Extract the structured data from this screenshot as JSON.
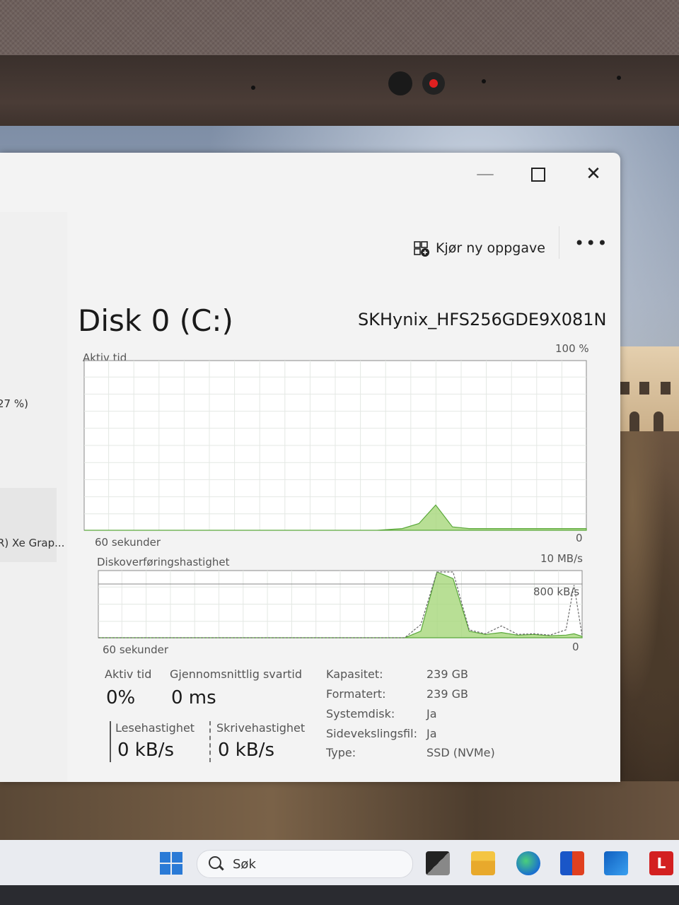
{
  "window": {
    "controls": {
      "minimize": "—",
      "close": "✕"
    },
    "toolbar": {
      "run_task_label": "Kjør ny oppgave",
      "more_label": "•••"
    },
    "sidebar": {
      "partial_pct": "27 %)",
      "partial_gpu": "R) Xe Grap..."
    }
  },
  "disk": {
    "title": "Disk 0 (C:)",
    "model": "SKHynix_HFS256GDE9X081N"
  },
  "charts": {
    "active_time": {
      "label": "Aktiv tid",
      "max_label": "100 %",
      "min_label": "0",
      "time_label": "60 sekunder"
    },
    "transfer": {
      "label": "Diskoverføringshastighet",
      "max_label": "10 MB/s",
      "mid_label": "800 kB/s",
      "min_label": "0",
      "time_label": "60 sekunder"
    }
  },
  "chart_data": [
    {
      "type": "area",
      "title": "Aktiv tid",
      "ylim": [
        0,
        100
      ],
      "x": [
        0,
        5,
        10,
        15,
        20,
        25,
        30,
        35,
        38,
        40,
        42,
        44,
        46,
        48,
        50,
        52,
        54,
        56,
        58,
        60
      ],
      "values": [
        0,
        0,
        0,
        0,
        0,
        0,
        0,
        0,
        1,
        4,
        15,
        2,
        1,
        1,
        1,
        1,
        1,
        1,
        1,
        1
      ],
      "unit": "%"
    },
    {
      "type": "area",
      "title": "Diskoverføringshastighet",
      "ylim": [
        0,
        10
      ],
      "unit": "MB/s",
      "x": [
        0,
        5,
        10,
        15,
        20,
        25,
        30,
        35,
        38,
        40,
        42,
        44,
        46,
        48,
        50,
        52,
        54,
        56,
        58,
        59,
        60
      ],
      "series": [
        {
          "values": [
            0,
            0,
            0,
            0,
            0,
            0,
            0,
            0,
            0,
            1,
            10,
            9,
            1,
            0.5,
            0.8,
            0.4,
            0.5,
            0.3,
            0.4,
            0.6,
            0.2
          ]
        },
        {
          "values": [
            0,
            0,
            0,
            0,
            0,
            0,
            0,
            0,
            0,
            2,
            10,
            10,
            1.2,
            0.6,
            1.8,
            0.5,
            0.6,
            0.4,
            1.2,
            8,
            0.3
          ]
        }
      ]
    }
  ],
  "stats": {
    "active_time": {
      "label": "Aktiv tid",
      "value": "0%"
    },
    "avg_response": {
      "label": "Gjennomsnittlig svartid",
      "value": "0 ms"
    },
    "read": {
      "label": "Lesehastighet",
      "value": "0 kB/s"
    },
    "write": {
      "label": "Skrivehastighet",
      "value": "0 kB/s"
    }
  },
  "info": [
    {
      "key": "Kapasitet:",
      "value": "239 GB"
    },
    {
      "key": "Formatert:",
      "value": "239 GB"
    },
    {
      "key": "Systemdisk:",
      "value": "Ja"
    },
    {
      "key": "Sidevekslingsfil:",
      "value": "Ja"
    },
    {
      "key": "Type:",
      "value": "SSD (NVMe)"
    }
  ],
  "taskbar": {
    "search_label": "Søk",
    "app_letter": "L",
    "icons": [
      "start-icon",
      "search-icon",
      "task-view-icon",
      "file-explorer-icon",
      "edge-icon",
      "store-icon",
      "outlook-icon",
      "app-l-icon"
    ]
  }
}
